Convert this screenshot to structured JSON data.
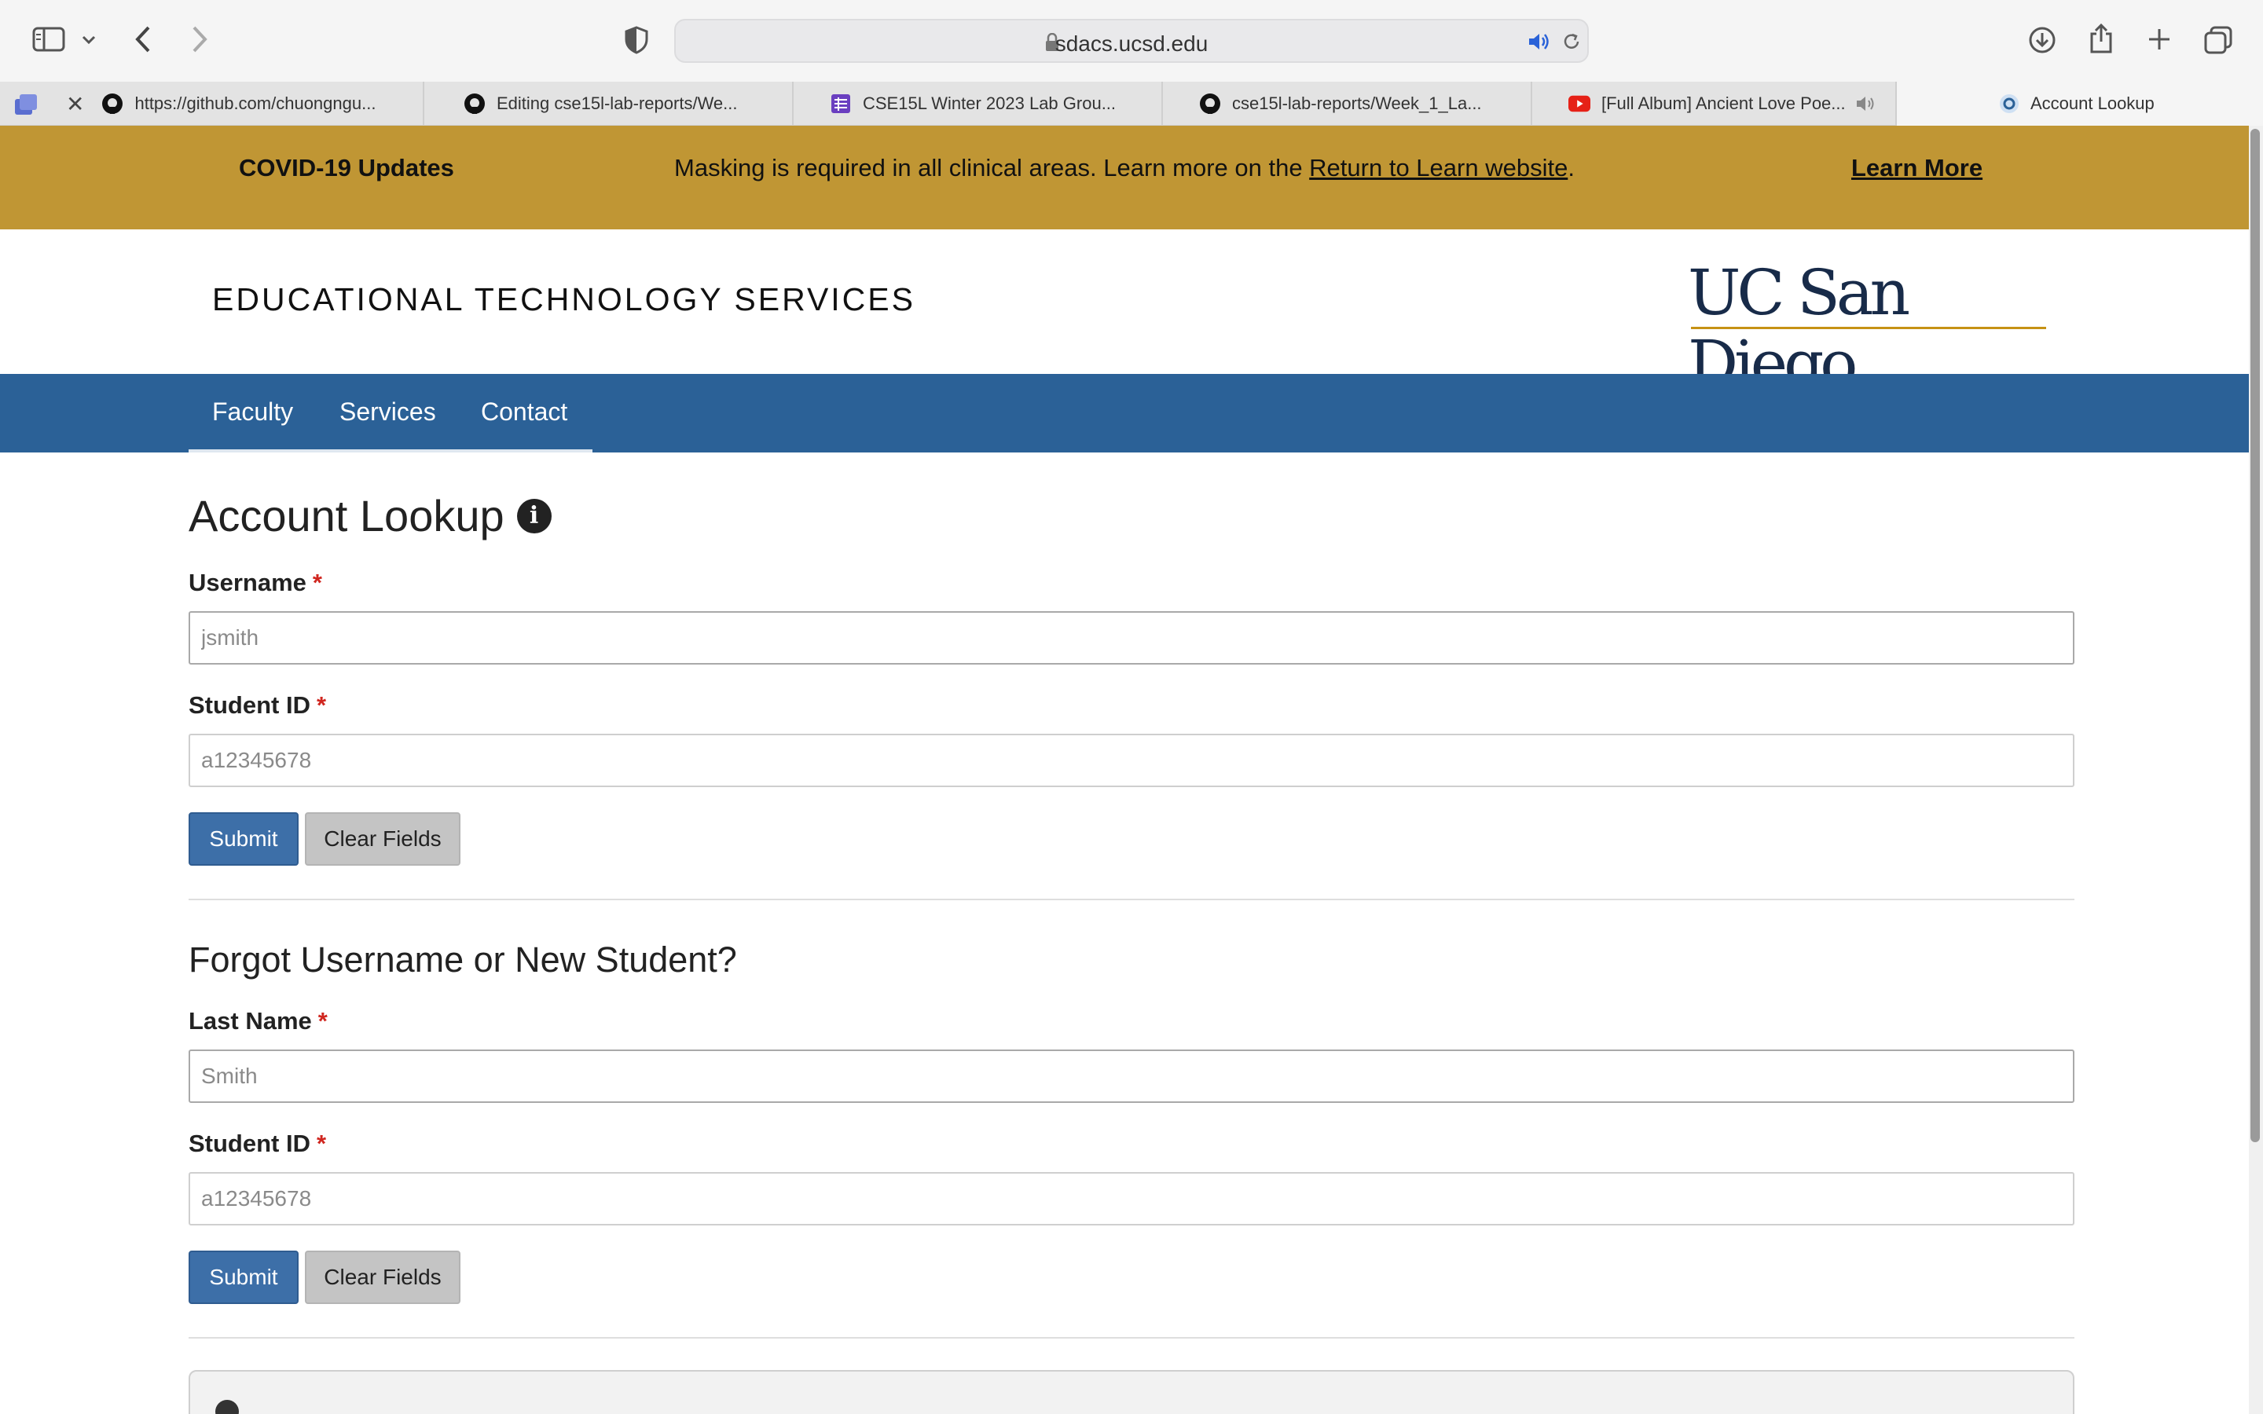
{
  "browser": {
    "address": "sdacs.ucsd.edu",
    "tabs": [
      {
        "label": "https://github.com/chuongngu...",
        "icon": "github-icon",
        "closable": true
      },
      {
        "label": "Editing cse15l-lab-reports/We...",
        "icon": "github-icon"
      },
      {
        "label": "CSE15L Winter 2023 Lab Grou...",
        "icon": "sheet-icon"
      },
      {
        "label": "cse15l-lab-reports/Week_1_La...",
        "icon": "github-icon"
      },
      {
        "label": "[Full Album] Ancient Love Poe...",
        "icon": "youtube-icon"
      },
      {
        "label": "Account Lookup",
        "icon": "site-icon",
        "active": true
      }
    ]
  },
  "banner": {
    "title": "COVID-19 Updates",
    "message_before": "Masking is required in all clinical areas. Learn more on the ",
    "message_link": "Return to Learn website",
    "message_after": ".",
    "learn_more": "Learn More",
    "color": "#c09634"
  },
  "header": {
    "department": "EDUCATIONAL TECHNOLOGY SERVICES",
    "logo_text": "UC San Diego"
  },
  "nav": {
    "color": "#2b6197",
    "items": [
      "Faculty",
      "Services",
      "Contact"
    ]
  },
  "account_lookup": {
    "title": "Account Lookup",
    "username_label": "Username",
    "username_placeholder": "jsmith",
    "student_id_label": "Student ID",
    "student_id_placeholder": "a12345678",
    "submit": "Submit",
    "clear": "Clear Fields"
  },
  "forgot": {
    "title": "Forgot Username or New Student?",
    "last_name_label": "Last Name",
    "last_name_placeholder": "Smith",
    "student_id_label": "Student ID",
    "student_id_placeholder": "a12345678",
    "submit": "Submit",
    "clear": "Clear Fields"
  },
  "required_marker": "*"
}
